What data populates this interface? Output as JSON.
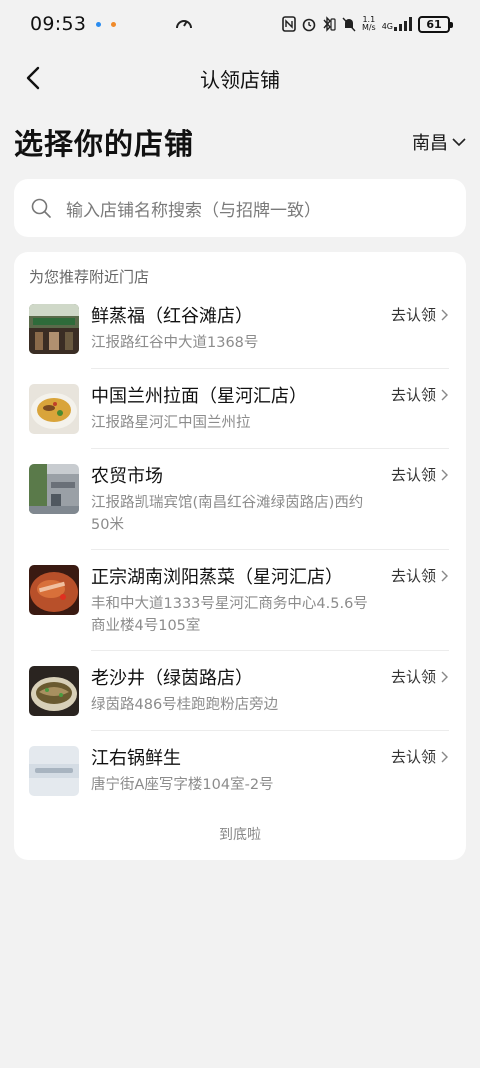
{
  "status": {
    "time": "09:53",
    "speed_value": "1.1",
    "speed_unit": "M/s",
    "network": "4G",
    "battery": "61"
  },
  "nav": {
    "title": "认领店铺"
  },
  "heading": {
    "title": "选择你的店铺",
    "city": "南昌"
  },
  "search": {
    "placeholder": "输入店铺名称搜索（与招牌一致）"
  },
  "list": {
    "title": "为您推荐附近门店",
    "claim_label": "去认领",
    "footer": "到底啦",
    "stores": [
      {
        "name": "鲜蒸福（红谷滩店）",
        "address": "江报路红谷中大道1368号"
      },
      {
        "name": "中国兰州拉面（星河汇店）",
        "address": "江报路星河汇中国兰州拉"
      },
      {
        "name": "农贸市场",
        "address": "江报路凯瑞宾馆(南昌红谷滩绿茵路店)西约50米"
      },
      {
        "name": "正宗湖南浏阳蒸菜（星河汇店）",
        "address": "丰和中大道1333号星河汇商务中心4.5.6号商业楼4号105室"
      },
      {
        "name": "老沙井（绿茵路店）",
        "address": "绿茵路486号桂跑跑粉店旁边"
      },
      {
        "name": "江右锅鲜生",
        "address": "唐宁街A座写字楼104室-2号"
      }
    ]
  },
  "colors": {
    "page_bg": "#f2f2f2",
    "card_bg": "#ffffff",
    "secondary_text": "#8c8c8c"
  }
}
